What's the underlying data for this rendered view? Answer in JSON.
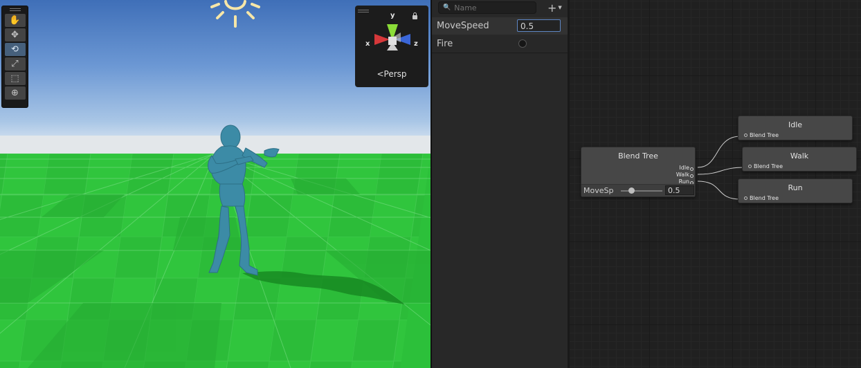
{
  "scene_view": {
    "gizmo": {
      "axis_x": "x",
      "axis_y": "y",
      "axis_z": "z",
      "projection": "<Persp"
    },
    "tools": [
      "hand-tool-icon",
      "move-tool-icon",
      "rotate-tool-icon",
      "scale-tool-icon",
      "rect-tool-icon",
      "transform-tool-icon"
    ],
    "active_tool": "rotate-tool-icon",
    "colors": {
      "ground": "#2ec63b",
      "sky": "#6c98d4",
      "character": "#3c8ba6"
    }
  },
  "parameters": {
    "search_placeholder": "Name",
    "add_label": "+",
    "items": [
      {
        "name": "MoveSpeed",
        "type": "float",
        "value": "0.5"
      },
      {
        "name": "Fire",
        "type": "trigger",
        "value": ""
      }
    ]
  },
  "graph": {
    "blend_tree": {
      "title": "Blend Tree",
      "outputs": [
        "Idle",
        "Walk",
        "Run"
      ],
      "param_label": "MoveSp",
      "param_value": "0.5",
      "slider_fraction": 0.25
    },
    "children": [
      {
        "title": "Idle",
        "subtitle": "Blend Tree"
      },
      {
        "title": "Walk",
        "subtitle": "Blend Tree"
      },
      {
        "title": "Run",
        "subtitle": "Blend Tree"
      }
    ]
  }
}
